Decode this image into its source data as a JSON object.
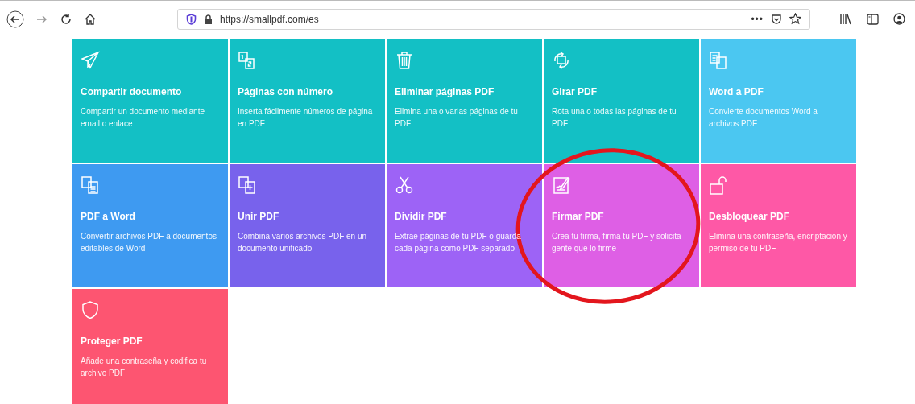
{
  "browser": {
    "url": "https://smallpdf.com/es",
    "page_actions": "•••"
  },
  "tools": [
    {
      "title": "Compartir documento",
      "description": "Compartir un documento mediante email o enlace",
      "color": "#13c0c5"
    },
    {
      "title": "Páginas con número",
      "description": "Inserta fácilmente números de página en PDF",
      "color": "#13c0c5"
    },
    {
      "title": "Eliminar páginas PDF",
      "description": "Elimina una o varias páginas de tu PDF",
      "color": "#13c0c5"
    },
    {
      "title": "Girar PDF",
      "description": "Rota una o todas las páginas de tu PDF",
      "color": "#13c0c5"
    },
    {
      "title": "Word a PDF",
      "description": "Convierte documentos Word a archivos PDF",
      "color": "#4bc7f1"
    },
    {
      "title": "PDF a Word",
      "description": "Convertir archivos PDF a documentos editables de Word",
      "color": "#3e9af1"
    },
    {
      "title": "Unir PDF",
      "description": "Combina varios archivos PDF en un documento unificado",
      "color": "#7862ec"
    },
    {
      "title": "Dividir PDF",
      "description": "Extrae páginas de tu PDF o guarda cada página como PDF separado",
      "color": "#9d63f6"
    },
    {
      "title": "Firmar PDF",
      "description": "Crea tu firma, firma tu PDF y solicita gente que lo firme",
      "color": "#de5fe5"
    },
    {
      "title": "Desbloquear PDF",
      "description": "Elimina una contraseña, encriptación y permiso de tu PDF",
      "color": "#fe58a6"
    },
    {
      "title": "Proteger PDF",
      "description": "Añade una contraseña y codifica tu archivo PDF",
      "color": "#fd5571"
    }
  ],
  "annotation": {
    "kind": "circle"
  }
}
